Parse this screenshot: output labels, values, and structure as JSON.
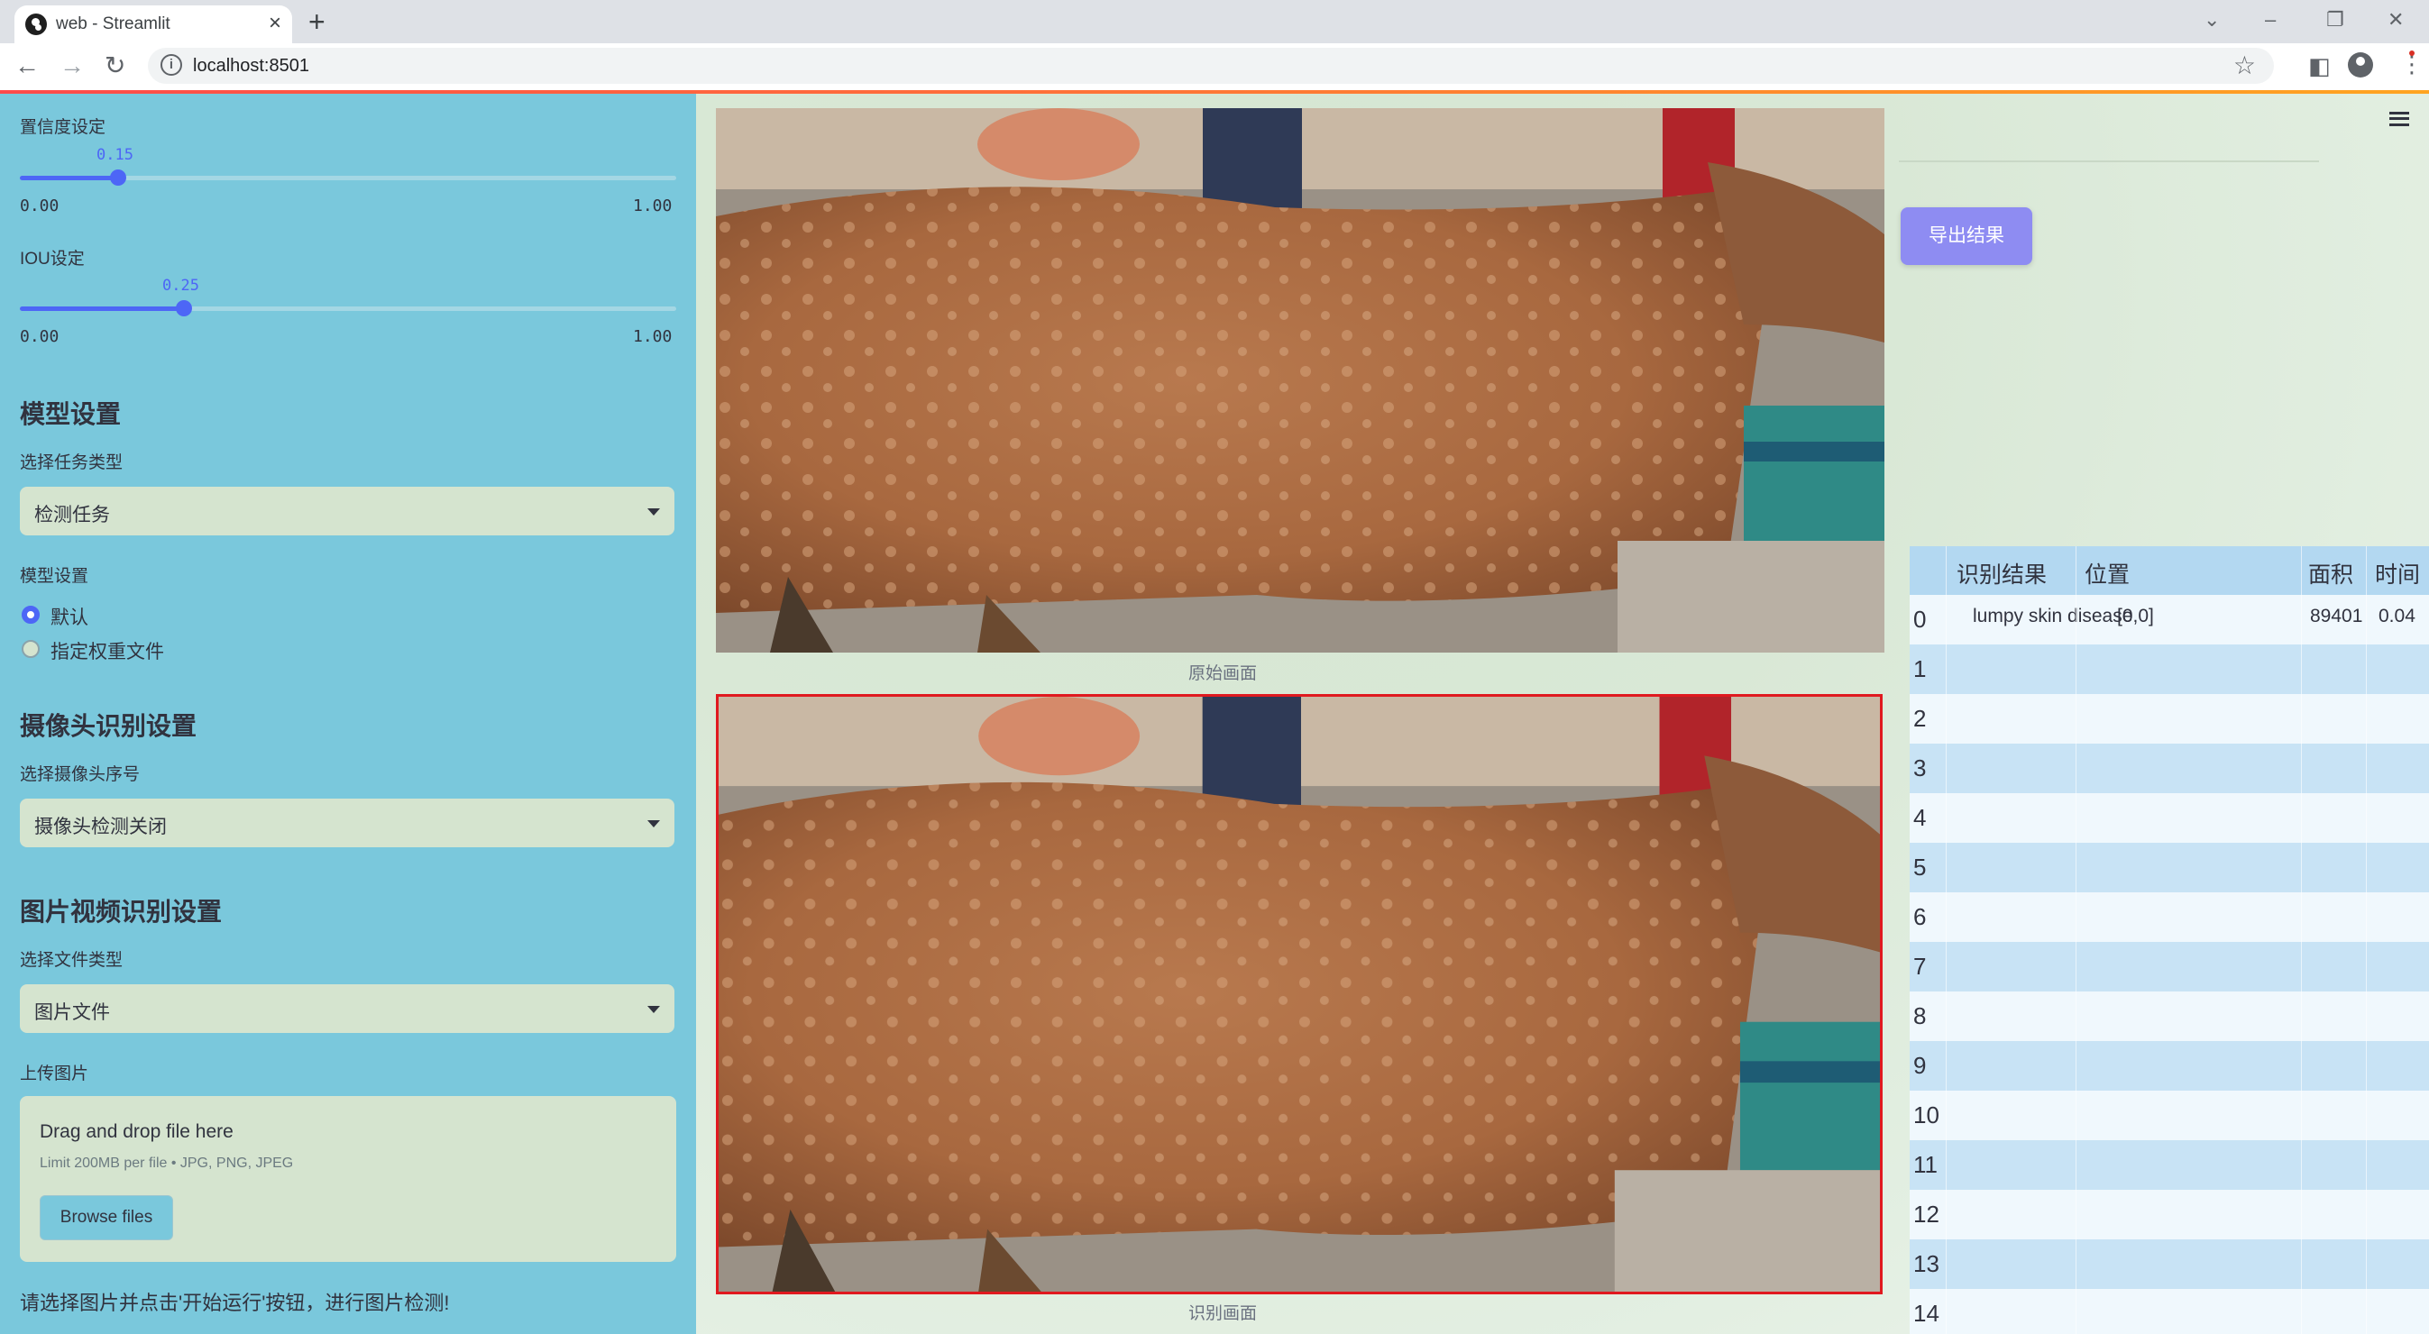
{
  "browser": {
    "tab_title": "web - Streamlit",
    "url": "localhost:8501"
  },
  "sidebar": {
    "confidence": {
      "label": "置信度设定",
      "value": "0.15",
      "value_fraction": 0.15,
      "min": "0.00",
      "max": "1.00"
    },
    "iou": {
      "label": "IOU设定",
      "value": "0.25",
      "value_fraction": 0.25,
      "min": "0.00",
      "max": "1.00"
    },
    "model_section": {
      "title": "模型设置",
      "task_label": "选择任务类型",
      "task_value": "检测任务",
      "model_label": "模型设置",
      "radio_default": "默认",
      "radio_custom": "指定权重文件"
    },
    "camera_section": {
      "title": "摄像头识别设置",
      "cam_label": "选择摄像头序号",
      "cam_value": "摄像头检测关闭"
    },
    "media_section": {
      "title": "图片视频识别设置",
      "file_type_label": "选择文件类型",
      "file_type_value": "图片文件",
      "upload_label": "上传图片",
      "drop_text": "Drag and drop file here",
      "limit_text": "Limit 200MB per file • JPG, PNG, JPEG",
      "browse_label": "Browse files"
    },
    "note": "请选择图片并点击'开始运行'按钮，进行图片检测!"
  },
  "main": {
    "caption_original": "原始画面",
    "caption_result": "识别画面",
    "export_label": "导出结果"
  },
  "table": {
    "headers": [
      "识别结果",
      "位置",
      "面积",
      "时间"
    ],
    "rows": [
      {
        "idx": "0",
        "result": "lumpy skin disease",
        "position": "[0,0]",
        "area": "89401",
        "time": "0.04"
      },
      {
        "idx": "1",
        "result": "",
        "position": "",
        "area": "",
        "time": ""
      },
      {
        "idx": "2",
        "result": "",
        "position": "",
        "area": "",
        "time": ""
      },
      {
        "idx": "3",
        "result": "",
        "position": "",
        "area": "",
        "time": ""
      },
      {
        "idx": "4",
        "result": "",
        "position": "",
        "area": "",
        "time": ""
      },
      {
        "idx": "5",
        "result": "",
        "position": "",
        "area": "",
        "time": ""
      },
      {
        "idx": "6",
        "result": "",
        "position": "",
        "area": "",
        "time": ""
      },
      {
        "idx": "7",
        "result": "",
        "position": "",
        "area": "",
        "time": ""
      },
      {
        "idx": "8",
        "result": "",
        "position": "",
        "area": "",
        "time": ""
      },
      {
        "idx": "9",
        "result": "",
        "position": "",
        "area": "",
        "time": ""
      },
      {
        "idx": "10",
        "result": "",
        "position": "",
        "area": "",
        "time": ""
      },
      {
        "idx": "11",
        "result": "",
        "position": "",
        "area": "",
        "time": ""
      },
      {
        "idx": "12",
        "result": "",
        "position": "",
        "area": "",
        "time": ""
      },
      {
        "idx": "13",
        "result": "",
        "position": "",
        "area": "",
        "time": ""
      },
      {
        "idx": "14",
        "result": "",
        "position": "",
        "area": "",
        "time": ""
      }
    ]
  },
  "colors": {
    "sidebar_bg": "#7ac8dc",
    "accent": "#4d66f6",
    "export_button": "#8e8cf2",
    "detection_box": "#e0191f"
  }
}
